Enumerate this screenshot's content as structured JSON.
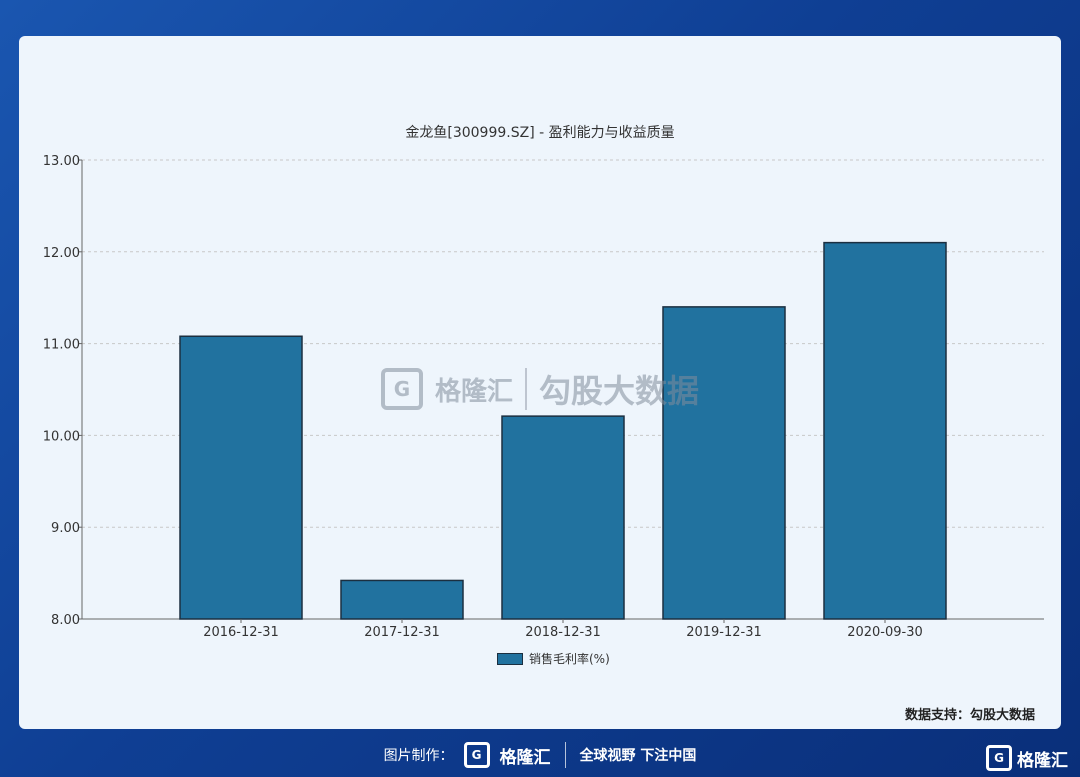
{
  "chart_data": {
    "type": "bar",
    "title": "金龙鱼[300999.SZ] - 盈利能力与收益质量",
    "categories": [
      "2016-12-31",
      "2017-12-31",
      "2018-12-31",
      "2019-12-31",
      "2020-09-30"
    ],
    "series": [
      {
        "name": "销售毛利率(%)",
        "values": [
          11.08,
          8.42,
          10.21,
          11.4,
          12.1
        ]
      }
    ],
    "ylim": [
      8.0,
      13.0
    ],
    "yticks": [
      "8.00",
      "9.00",
      "10.00",
      "11.00",
      "12.00",
      "13.00"
    ],
    "grid": true,
    "legend_position": "bottom-center",
    "bar_color": "#21729f"
  },
  "watermark": {
    "logo_glyph": "G",
    "name": "格隆汇",
    "data_brand": "勾股大数据"
  },
  "support_text": "数据支持：勾股大数据",
  "footer": {
    "label": "图片制作：",
    "logo_glyph": "G",
    "logo_name": "格隆汇",
    "slogan": "全球视野 下注中国"
  },
  "corner_logo": {
    "glyph": "G",
    "name": "格隆汇"
  }
}
